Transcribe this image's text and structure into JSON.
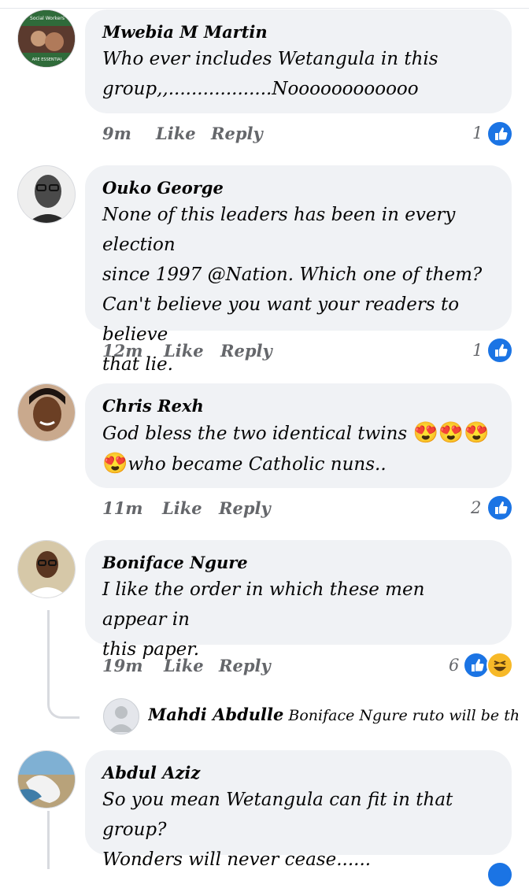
{
  "comments": [
    {
      "author": "Mwebia M Martin",
      "lines": [
        "Who ever includes Wetangula in this",
        "group,,..................Noooooooooooo"
      ],
      "time": "9m",
      "like": "Like",
      "reply": "Reply",
      "reaction_count": "1",
      "avatar_caption": [
        "Social Workers",
        "ARE ESSENTIAL"
      ]
    },
    {
      "author": "Ouko George",
      "lines": [
        "None of this leaders has been in every election",
        "since 1997 @Nation. Which one of them?",
        "Can't believe you want your readers to believe",
        "that lie."
      ],
      "time": "12m",
      "like": "Like",
      "reply": "Reply",
      "reaction_count": "1"
    },
    {
      "author": "Chris Rexh",
      "line1": "God bless the two identical twins ",
      "emojis1": "😍😍😍",
      "emojis2": "😍",
      "line2": "who became Catholic nuns..",
      "time": "11m",
      "like": "Like",
      "reply": "Reply",
      "reaction_count": "2"
    },
    {
      "author": "Boniface Ngure",
      "lines": [
        "I like the order in which these men appear in",
        "this paper."
      ],
      "time": "19m",
      "like": "Like",
      "reply": "Reply",
      "reaction_count": "6",
      "reply_preview": {
        "author": "Mahdi Abdulle",
        "text": "Boniface Ngure  ruto will be the p..."
      }
    },
    {
      "author": "Abdul Aziz",
      "lines": [
        "So you mean Wetangula can fit in that group?",
        "Wonders will never cease......"
      ]
    }
  ],
  "colors": {
    "bubble": "#f0f2f5",
    "like_blue": "#1b74e4",
    "meta_gray": "#65676b"
  },
  "icons": [
    "like-reaction-icon",
    "haha-reaction-icon",
    "default-avatar-icon"
  ]
}
